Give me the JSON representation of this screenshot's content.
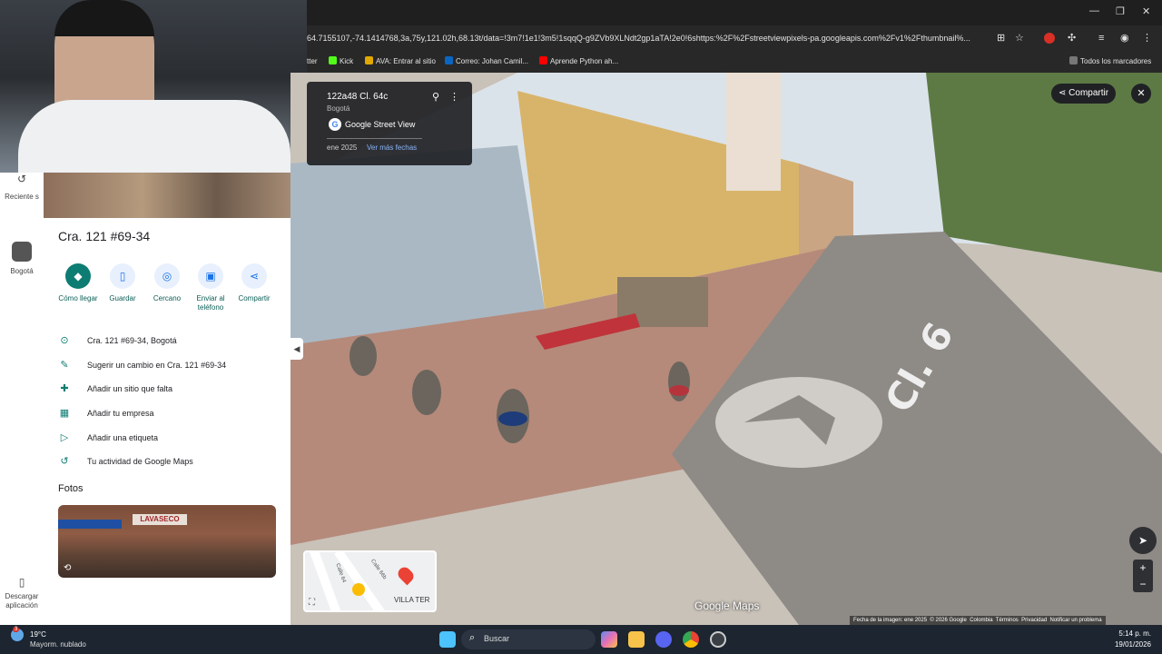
{
  "browser": {
    "url": "64.7155107,-74.1414768,3a,75y,121.02h,68.13t/data=!3m7!1e1!3m5!1sqqQ-g9ZVb9XLNdt2gp1aTA!2e0!6shttps:%2F%2Fstreetviewpixels-pa.googleapis.com%2Fv1%2Fthumbnail%...",
    "bookmarks": [
      {
        "label": "tter",
        "color": "#1d9bf0"
      },
      {
        "label": "Kick",
        "color": "#53fc18"
      },
      {
        "label": "AVA: Entrar al sitio",
        "color": "#e0a800"
      },
      {
        "label": "Correo: Johan Camil...",
        "color": "#0a66c2"
      },
      {
        "label": "Aprende Python ah...",
        "color": "#ff0000"
      }
    ],
    "all_bookmarks": "Todos los marcadores"
  },
  "rail": {
    "recent": "Reciente s",
    "bogota": "Bogotá",
    "download": "Descargar aplicación"
  },
  "place": {
    "title": "Cra. 121 #69-34",
    "actions": [
      {
        "label": "Cómo llegar",
        "icon": "◆"
      },
      {
        "label": "Guardar",
        "icon": "▯"
      },
      {
        "label": "Cercano",
        "icon": "◎"
      },
      {
        "label": "Enviar al teléfono",
        "icon": "▣"
      },
      {
        "label": "Compartir",
        "icon": "⋖"
      }
    ],
    "info": [
      {
        "text": "Cra. 121 #69-34, Bogotá",
        "icon": "⊙"
      },
      {
        "text": "Sugerir un cambio en Cra. 121 #69-34",
        "icon": "✎"
      },
      {
        "text": "Añadir un sitio que falta",
        "icon": "✚"
      },
      {
        "text": "Añadir tu empresa",
        "icon": "▦"
      },
      {
        "text": "Añadir una etiqueta",
        "icon": "▷"
      },
      {
        "text": "Tu actividad de Google Maps",
        "icon": "↺"
      }
    ],
    "photos_label": "Fotos",
    "photo_sign": "LAVASECO"
  },
  "streetview": {
    "address": "122a48 Cl. 64c",
    "city": "Bogotá",
    "brand": "Google Street View",
    "date": "ene 2025",
    "more_dates": "Ver más fechas",
    "share": "Compartir",
    "watermark": "Google Maps",
    "street_label": "Cl. 6",
    "footer": [
      "Fecha de la imagen: ene 2025",
      "© 2026 Google",
      "Colombia",
      "Términos",
      "Privacidad",
      "Notificar un problema"
    ]
  },
  "minimap": {
    "label": "VILLA TER",
    "street1": "Calle 64",
    "street2": "Calle 66b"
  },
  "taskbar": {
    "temp": "19°C",
    "weather": "Mayorm. nublado",
    "search": "Buscar",
    "time": "5:14 p. m.",
    "date": "19/01/2026",
    "badge": "3"
  }
}
